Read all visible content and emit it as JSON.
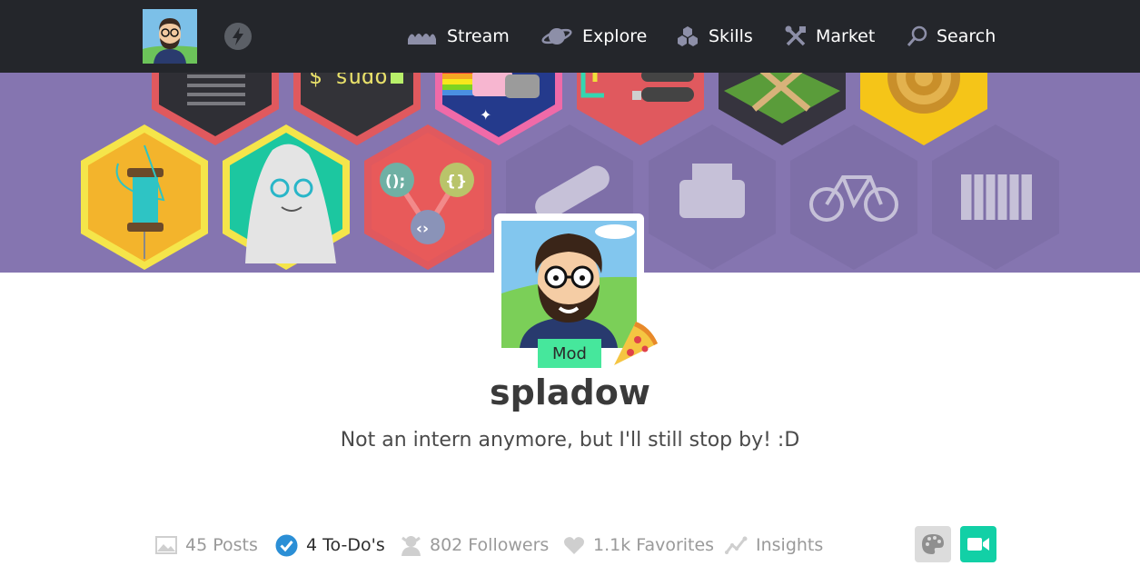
{
  "nav": {
    "items": [
      {
        "label": "Stream",
        "icon": "stream-icon"
      },
      {
        "label": "Explore",
        "icon": "planet-icon"
      },
      {
        "label": "Skills",
        "icon": "skills-icon"
      },
      {
        "label": "Market",
        "icon": "tools-icon"
      },
      {
        "label": "Search",
        "icon": "search-icon"
      }
    ]
  },
  "banner": {
    "sudo_text": "$ sudo"
  },
  "profile": {
    "badge": "Mod",
    "username": "spladow",
    "bio": "Not an intern anymore, but I'll still stop by!  :D"
  },
  "stats": [
    {
      "label": "45 Posts",
      "icon": "image-icon"
    },
    {
      "label": "4 To-Do's",
      "icon": "check-circle-icon"
    },
    {
      "label": "802 Followers",
      "icon": "followers-icon"
    },
    {
      "label": "1.1k Favorites",
      "icon": "heart-icon"
    },
    {
      "label": "Insights",
      "icon": "insights-icon"
    }
  ],
  "actions": {
    "palette": "palette-icon",
    "video": "video-camera-icon"
  },
  "colors": {
    "topbar": "#24262b",
    "banner": "#8575b0",
    "mod_badge": "#46e79c",
    "todo_check": "#2b8fd6",
    "video_button": "#12d0a6"
  }
}
